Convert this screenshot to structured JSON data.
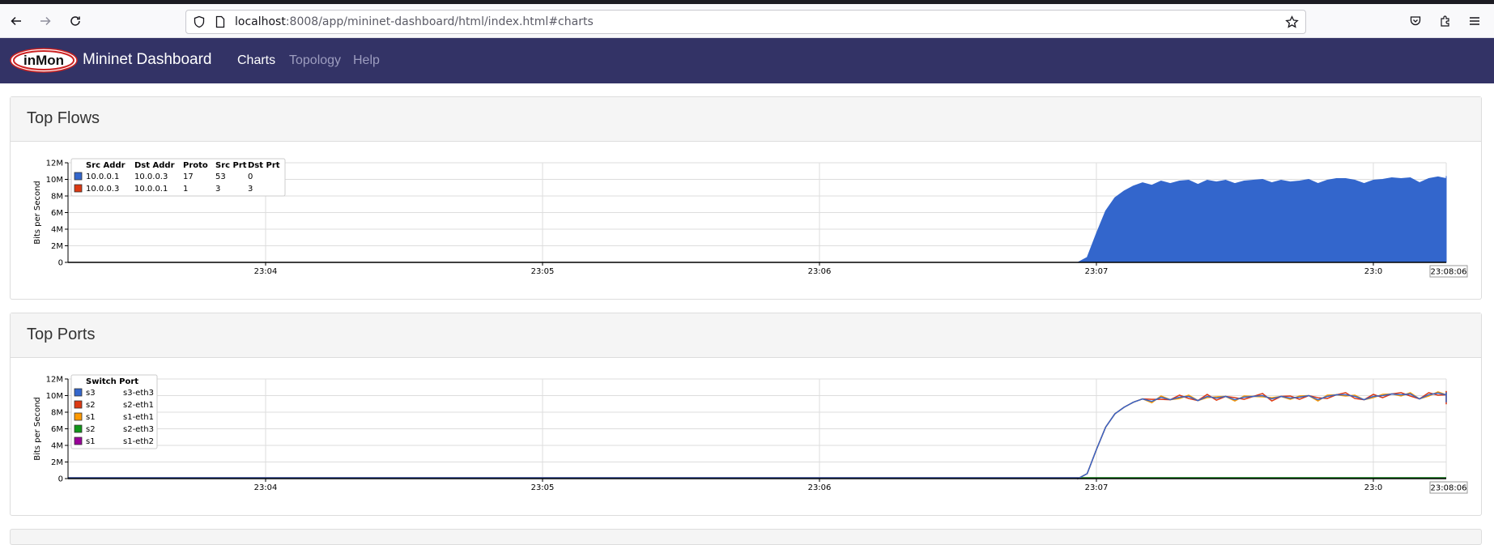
{
  "browser": {
    "url_host": "localhost",
    "url_rest": ":8008/app/mininet-dashboard/html/index.html#charts"
  },
  "navbar": {
    "logo_text": "inMon",
    "brand": "Mininet Dashboard",
    "links": [
      {
        "label": "Charts",
        "active": true
      },
      {
        "label": "Topology",
        "active": false
      },
      {
        "label": "Help",
        "active": false
      }
    ]
  },
  "panels": [
    {
      "title": "Top Flows"
    },
    {
      "title": "Top Ports"
    }
  ],
  "colors": {
    "navbar_bg": "#333366",
    "blue": "#3366cc",
    "red": "#dc3912",
    "orange": "#ff9900",
    "green": "#109618",
    "purple": "#990099"
  },
  "chart_data": [
    {
      "type": "area",
      "title": "Top Flows",
      "ylabel": "Bits per Second",
      "yticks": [
        "0",
        "2M",
        "4M",
        "6M",
        "8M",
        "10M",
        "12M"
      ],
      "ylim": [
        0,
        12000000
      ],
      "xticks": [
        "23:04",
        "23:05",
        "23:06",
        "23:07",
        "23:0"
      ],
      "current_time_label": "23:08:06",
      "legend_headers": [
        "Src Addr",
        "Dst Addr",
        "Proto",
        "Src Prt",
        "Dst Prt"
      ],
      "legend_rows": [
        {
          "color": "#3366cc",
          "cells": [
            "10.0.0.1",
            "10.0.0.3",
            "17",
            "53",
            "0"
          ]
        },
        {
          "color": "#dc3912",
          "cells": [
            "10.0.0.3",
            "10.0.0.1",
            "1",
            "3",
            "3"
          ]
        }
      ],
      "x_seconds_start": 0,
      "series": [
        {
          "name": "10.0.0.1 10.0.0.3 17 53 0",
          "color": "#3366cc",
          "t": [
            236,
            238,
            240,
            242,
            244,
            246,
            248,
            250,
            252,
            254,
            256,
            258,
            260,
            262,
            264,
            266,
            268,
            270,
            272,
            274,
            276,
            278,
            280,
            282,
            284,
            286,
            288,
            290,
            292,
            294,
            296,
            298,
            300,
            302,
            304,
            306,
            308,
            310,
            312,
            314,
            316,
            318,
            320,
            322,
            324,
            326,
            328,
            330,
            332,
            334,
            336,
            338,
            340,
            342,
            344,
            346,
            348,
            350,
            352,
            354,
            356,
            358,
            360,
            362,
            364,
            366,
            368,
            370,
            372,
            374,
            376,
            378,
            380,
            382,
            384,
            386
          ],
          "values": [
            0,
            0.6,
            3.5,
            6.2,
            7.8,
            8.6,
            9.2,
            9.6,
            9.3,
            9.8,
            9.5,
            9.8,
            9.9,
            9.4,
            9.9,
            9.7,
            9.9,
            9.5,
            9.8,
            9.9,
            10.0,
            9.6,
            9.9,
            9.7,
            9.8,
            10.0,
            9.5,
            9.9,
            10.1,
            10.1,
            9.9,
            9.5,
            9.9,
            10.0,
            10.2,
            10.1,
            10.2,
            9.6,
            10.1,
            10.3,
            10.1,
            10.2,
            9.6,
            9.9,
            10.2,
            9.5,
            10.0,
            10.2,
            10.1,
            10.2,
            9.8,
            10.0,
            10.3,
            10.1,
            10.2,
            10.3,
            10.2,
            10.4,
            10.3,
            10.2,
            10.3,
            10.4,
            10.3,
            10.0,
            9.6,
            9.4,
            9.9,
            10.2,
            10.3,
            10.2,
            9.9,
            9.4,
            9.2,
            9.3,
            9.4,
            9.4
          ]
        }
      ]
    },
    {
      "type": "line",
      "title": "Top Ports",
      "ylabel": "Bits per Second",
      "yticks": [
        "0",
        "2M",
        "4M",
        "6M",
        "8M",
        "10M",
        "12M"
      ],
      "ylim": [
        0,
        12000000
      ],
      "xticks": [
        "23:04",
        "23:05",
        "23:06",
        "23:07",
        "23:0"
      ],
      "current_time_label": "23:08:06",
      "legend_headers": [
        "Switch Port"
      ],
      "legend_rows": [
        {
          "color": "#3366cc",
          "cells": [
            "s3",
            "s3-eth3"
          ]
        },
        {
          "color": "#dc3912",
          "cells": [
            "s2",
            "s2-eth1"
          ]
        },
        {
          "color": "#ff9900",
          "cells": [
            "s1",
            "s1-eth1"
          ]
        },
        {
          "color": "#109618",
          "cells": [
            "s2",
            "s2-eth3"
          ]
        },
        {
          "color": "#990099",
          "cells": [
            "s1",
            "s1-eth2"
          ]
        }
      ],
      "series": [
        {
          "name": "s3 s3-eth3",
          "color": "#3366cc",
          "shape": "flow"
        },
        {
          "name": "s2 s2-eth1",
          "color": "#dc3912",
          "shape": "flow"
        },
        {
          "name": "s1 s1-eth1",
          "color": "#ff9900",
          "shape": "flow"
        },
        {
          "name": "s2 s2-eth3",
          "color": "#109618",
          "shape": "flat"
        },
        {
          "name": "s1 s1-eth2",
          "color": "#990099",
          "shape": "flat"
        }
      ]
    }
  ]
}
